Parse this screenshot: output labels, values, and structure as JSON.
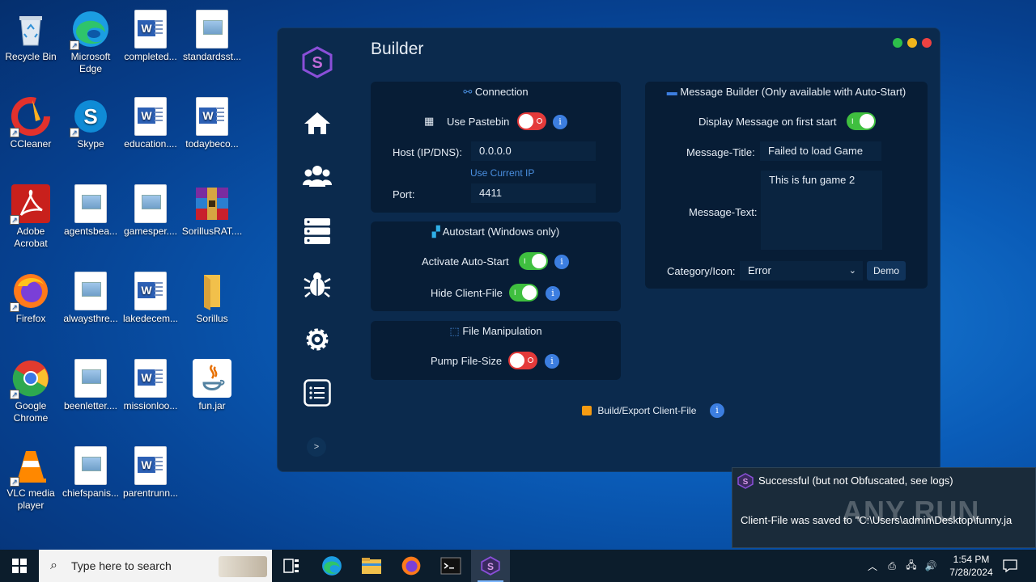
{
  "desktop": {
    "icons": [
      {
        "label": "Recycle Bin"
      },
      {
        "label": "Microsoft Edge"
      },
      {
        "label": "completed..."
      },
      {
        "label": "standardsst..."
      },
      {
        "label": "CCleaner"
      },
      {
        "label": "Skype"
      },
      {
        "label": "education...."
      },
      {
        "label": "todaybeco..."
      },
      {
        "label": "Adobe Acrobat"
      },
      {
        "label": "agentsbea..."
      },
      {
        "label": "gamesper...."
      },
      {
        "label": "SorillusRAT...."
      },
      {
        "label": "Firefox"
      },
      {
        "label": "alwaysthre..."
      },
      {
        "label": "lakedecem..."
      },
      {
        "label": "Sorillus"
      },
      {
        "label": "Google Chrome"
      },
      {
        "label": "beenletter...."
      },
      {
        "label": "missionloo..."
      },
      {
        "label": "fun.jar"
      },
      {
        "label": "VLC media player"
      },
      {
        "label": "chiefspanis..."
      },
      {
        "label": "parentrunn..."
      }
    ]
  },
  "app": {
    "title": "Builder",
    "accent": "#8a4fd8",
    "connection": {
      "title": "Connection",
      "use_pastebin_label": "Use Pastebin",
      "use_pastebin_on": false,
      "host_label": "Host (IP/DNS):",
      "host_value": "0.0.0.0",
      "use_current_ip": "Use Current IP",
      "port_label": "Port:",
      "port_value": "4411"
    },
    "autostart": {
      "title": "Autostart (Windows only)",
      "activate_label": "Activate Auto-Start",
      "activate_on": true,
      "hide_label": "Hide Client-File",
      "hide_on": true
    },
    "file_manipulation": {
      "title": "File Manipulation",
      "pump_label": "Pump File-Size",
      "pump_on": false
    },
    "message_builder": {
      "title": "Message Builder (Only available with Auto-Start)",
      "display_label": "Display Message on first start",
      "display_on": true,
      "msg_title_label": "Message-Title:",
      "msg_title_value": "Failed to load Game",
      "msg_text_label": "Message-Text:",
      "msg_text_value": "This is fun game 2",
      "category_label": "Category/Icon:",
      "category_value": "Error",
      "demo_label": "Demo"
    },
    "build_label": "Build/Export Client-File",
    "expand_label": ">",
    "info_glyph": "i"
  },
  "toast": {
    "title": "Successful (but not Obfuscated, see logs)",
    "message": "Client-File was saved to \"C:\\Users\\admin\\Desktop\\funny.ja"
  },
  "watermark": "ANY RUN",
  "taskbar": {
    "search_placeholder": "Type here to search",
    "time": "1:54 PM",
    "date": "7/28/2024"
  }
}
